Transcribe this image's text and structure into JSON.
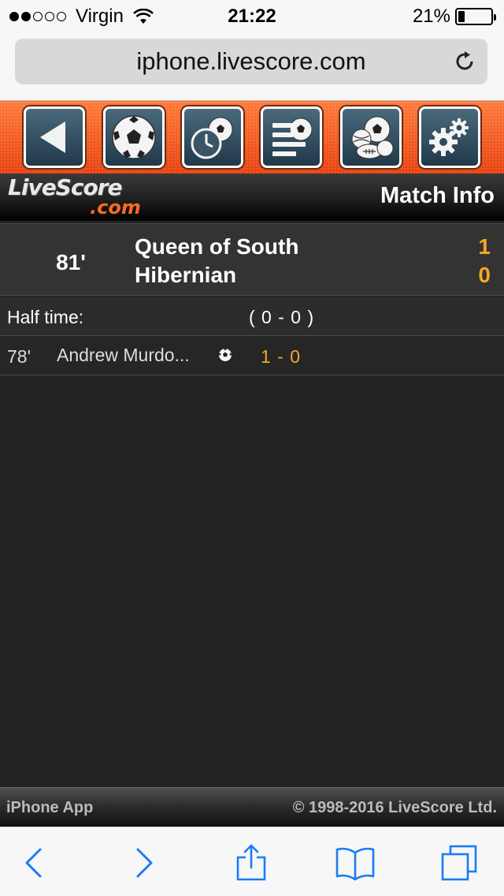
{
  "status_bar": {
    "carrier": "Virgin",
    "time": "21:22",
    "battery": "21%",
    "battery_level": 0.21,
    "signal_bars_filled": 2,
    "signal_bars_total": 5
  },
  "browser": {
    "url": "iphone.livescore.com"
  },
  "nav": {
    "buttons": [
      {
        "icon": "back-arrow-icon"
      },
      {
        "icon": "soccer-ball-icon"
      },
      {
        "icon": "clock-ball-icon"
      },
      {
        "icon": "list-ball-icon"
      },
      {
        "icon": "multi-sports-icon"
      },
      {
        "icon": "settings-gears-icon"
      }
    ]
  },
  "header": {
    "logo_top": "LiveScore",
    "logo_bottom": ".com",
    "title": "Match Info"
  },
  "match": {
    "minute": "81'",
    "home_team": "Queen of South",
    "away_team": "Hibernian",
    "home_score": "1",
    "away_score": "0"
  },
  "half_time": {
    "label": "Half time:",
    "score": "( 0 - 0 )"
  },
  "events": [
    {
      "minute": "78'",
      "player": "Andrew Murdo...",
      "icon": "soccer-ball-icon",
      "score": "1 - 0"
    }
  ],
  "footer": {
    "left": "iPhone App",
    "right": "© 1998-2016 LiveScore Ltd."
  },
  "colors": {
    "accent_orange": "#f0501e",
    "score_gold": "#f5a623",
    "ios_blue": "#1a7cf5"
  }
}
